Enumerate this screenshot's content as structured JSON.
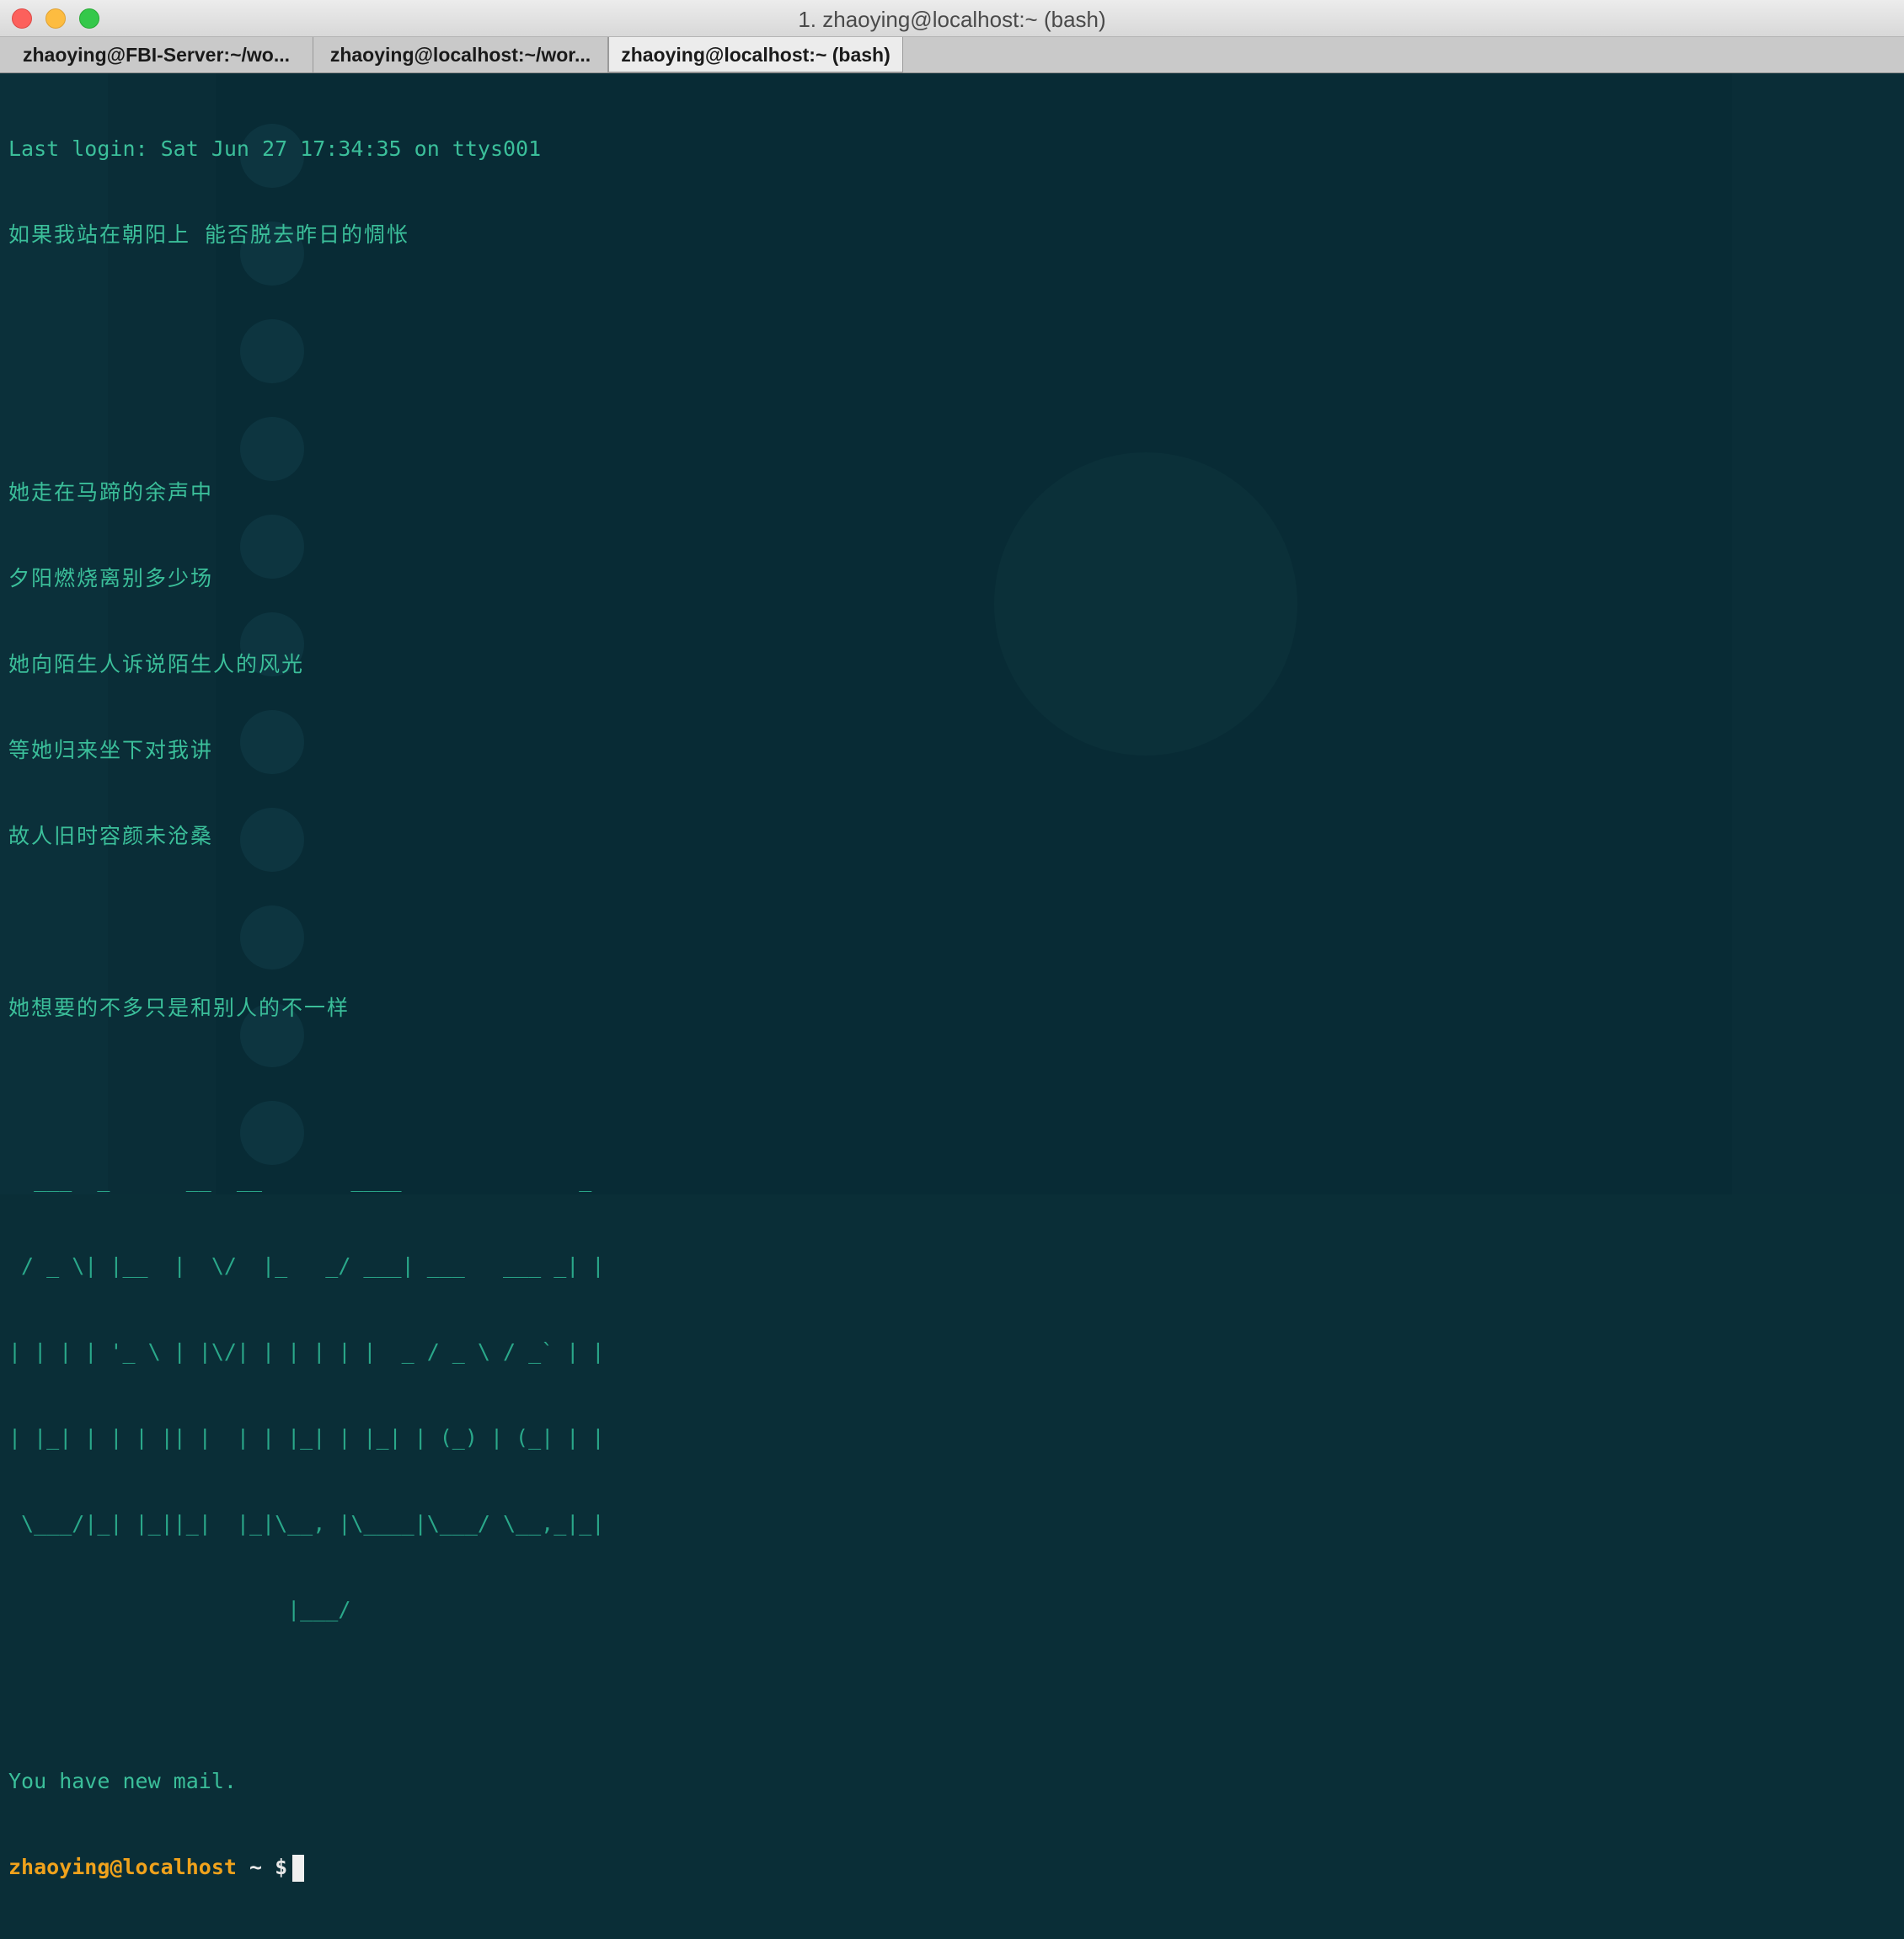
{
  "window": {
    "title": "1. zhaoying@localhost:~ (bash)"
  },
  "tabs": [
    {
      "label": "zhaoying@FBI-Server:~/wo..."
    },
    {
      "label": "zhaoying@localhost:~/wor..."
    },
    {
      "label": "zhaoying@localhost:~ (bash)"
    }
  ],
  "terminal": {
    "last_login": "Last login: Sat Jun 27 17:34:35 on ttys001",
    "poem": [
      "如果我站在朝阳上 能否脱去昨日的惆怅",
      "",
      "",
      "她走在马蹄的余声中",
      "夕阳燃烧离别多少场",
      "她向陌生人诉说陌生人的风光",
      "等她归来坐下对我讲",
      "故人旧时容颜未沧桑",
      "",
      "她想要的不多只是和别人的不一样"
    ],
    "banner": [
      "",
      "  ___  _      __  __       ____              _ ",
      " / _ \\| |__  |  \\/  |_   _/ ___| ___   ___ _| |",
      "| | | | '_ \\ | |\\/| | | | | |  _ / _ \\ / _` | |",
      "| |_| | | | || |  | | |_| | |_| | (_) | (_| | |",
      " \\___/|_| |_||_|  |_|\\__, |\\____|\\___/ \\__,_|_|",
      "                      |___/                    ",
      ""
    ],
    "mail": "You have new mail.",
    "prompt_user": "zhaoying@localhost",
    "prompt_rest": " ~ $"
  }
}
